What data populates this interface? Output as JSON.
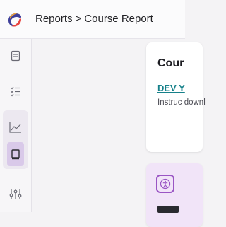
{
  "header": {
    "breadcrumb_parent": "Reports",
    "breadcrumb_separator": ">",
    "breadcrumb_current": "Course Report"
  },
  "sidebar": {
    "items": [
      {
        "icon": "document-icon"
      },
      {
        "icon": "checklist-icon"
      },
      {
        "icon": "line-chart-icon"
      },
      {
        "icon": "book-icon"
      },
      {
        "icon": "sliders-icon"
      }
    ]
  },
  "cards": [
    {
      "title": "Cour",
      "link": "DEV Y",
      "description": "Instruc downl"
    },
    {
      "icon": "accessibility-icon"
    }
  ],
  "colors": {
    "accent_purple": "#9a55c4",
    "link_teal": "#16818a",
    "active_highlight": "#d9c9e9"
  }
}
